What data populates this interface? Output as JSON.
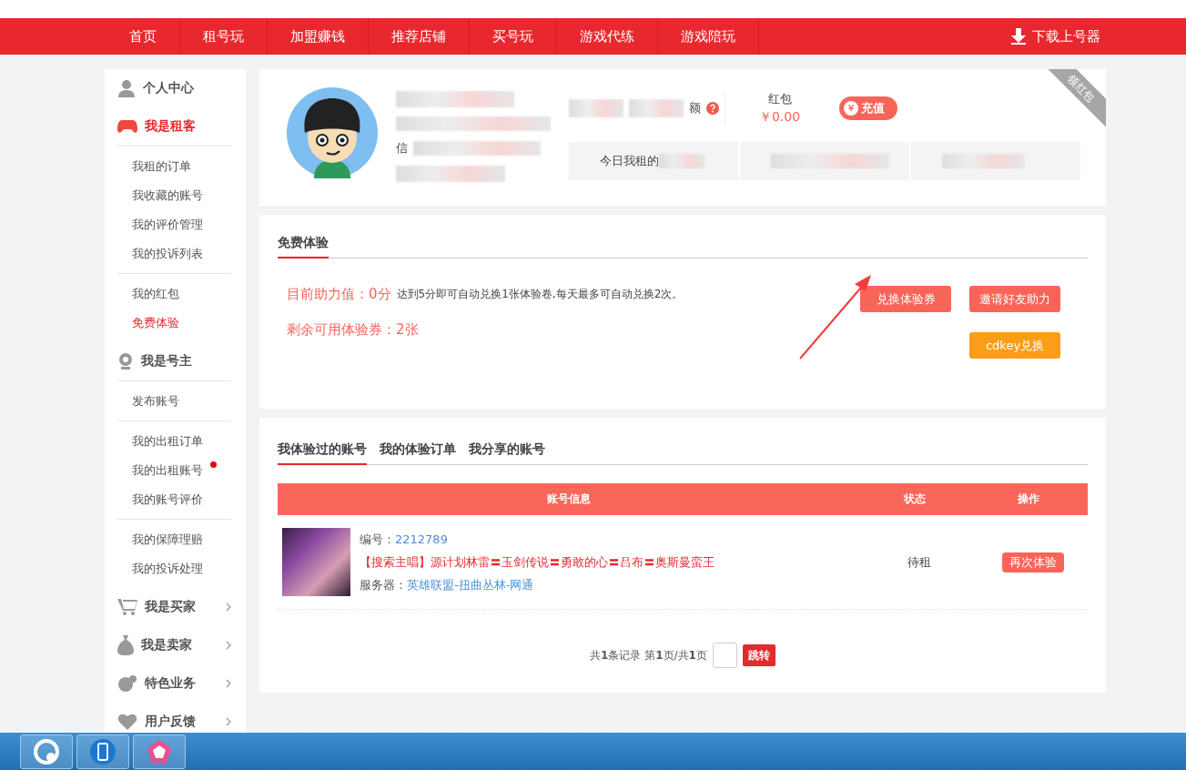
{
  "nav": {
    "items": [
      {
        "label": "首页",
        "selected": false
      },
      {
        "label": "租号玩",
        "selected": false
      },
      {
        "label": "加盟赚钱",
        "selected": false
      },
      {
        "label": "推荐店铺",
        "selected": false
      },
      {
        "label": "买号玩",
        "selected": false
      },
      {
        "label": "游戏代练",
        "selected": false
      },
      {
        "label": "游戏陪玩",
        "selected": false
      }
    ],
    "download": "下载上号器"
  },
  "sidebar": {
    "groups": [
      {
        "title": "个人中心",
        "active": false,
        "expandable": false
      },
      {
        "title": "我是租客",
        "active": true,
        "expandable": false,
        "sections": [
          [
            {
              "label": "我租的订单",
              "selected": false,
              "dot": false
            },
            {
              "label": "我收藏的账号",
              "selected": false,
              "dot": false
            },
            {
              "label": "我的评价管理",
              "selected": false,
              "dot": false
            },
            {
              "label": "我的投诉列表",
              "selected": false,
              "dot": false
            }
          ],
          [
            {
              "label": "我的红包",
              "selected": false,
              "dot": false
            },
            {
              "label": "免费体验",
              "selected": true,
              "dot": false
            }
          ]
        ]
      },
      {
        "title": "我是号主",
        "active": false,
        "expandable": false,
        "sections": [
          [
            {
              "label": "发布账号",
              "selected": false,
              "dot": false
            }
          ],
          [
            {
              "label": "我的出租订单",
              "selected": false,
              "dot": false
            },
            {
              "label": "我的出租账号",
              "selected": false,
              "dot": true
            },
            {
              "label": "我的账号评价",
              "selected": false,
              "dot": false
            }
          ],
          [
            {
              "label": "我的保障理赔",
              "selected": false,
              "dot": false
            },
            {
              "label": "我的投诉处理",
              "selected": false,
              "dot": false
            }
          ]
        ]
      },
      {
        "title": "我是买家",
        "active": false,
        "expandable": true
      },
      {
        "title": "我是卖家",
        "active": false,
        "expandable": true
      },
      {
        "title": "特色业务",
        "active": false,
        "expandable": true
      },
      {
        "title": "用户反馈",
        "active": false,
        "expandable": true
      }
    ]
  },
  "profile": {
    "balance_suffix": "额",
    "credit_prefix": "信",
    "redpacket_label": "红包",
    "redpacket_amount": "￥0.00",
    "recharge_icon": "￥",
    "recharge": "充值",
    "ribbon": "领红包",
    "stats": [
      "今日我租的"
    ]
  },
  "trial": {
    "tab": "免费体验",
    "assist": "目前助力值：0分",
    "note": "达到5分即可自动兑换1张体验卷,每天最多可自动兑换2次。",
    "remaining": "剩余可用体验券：2张",
    "buttons": [
      {
        "label": "兑换体验券",
        "color": "#f96459"
      },
      {
        "label": "邀请好友助力",
        "color": "#f96459"
      },
      {
        "label": "cdkey兑换",
        "color": "#fb9d18"
      }
    ]
  },
  "accounts": {
    "tabs": [
      {
        "label": "我体验过的账号",
        "selected": true
      },
      {
        "label": "我的体验订单",
        "selected": false
      },
      {
        "label": "我分享的账号",
        "selected": false
      }
    ],
    "columns": [
      "账号信息",
      "状态",
      "操作"
    ],
    "rows": [
      {
        "id_label": "编号：",
        "id": "2212789",
        "title": "【搜索主唱】源计划林雷〓玉剑传说〓勇敢的心〓吕布〓奥斯曼蛮王",
        "server_label": "服务器：",
        "server": "英雄联盟-扭曲丛林-网通",
        "status": "待租",
        "action": "再次体验"
      }
    ],
    "pagination": {
      "summary": "共**1**条记录 第**1**页/共**1**页",
      "jump": "跳转"
    }
  }
}
